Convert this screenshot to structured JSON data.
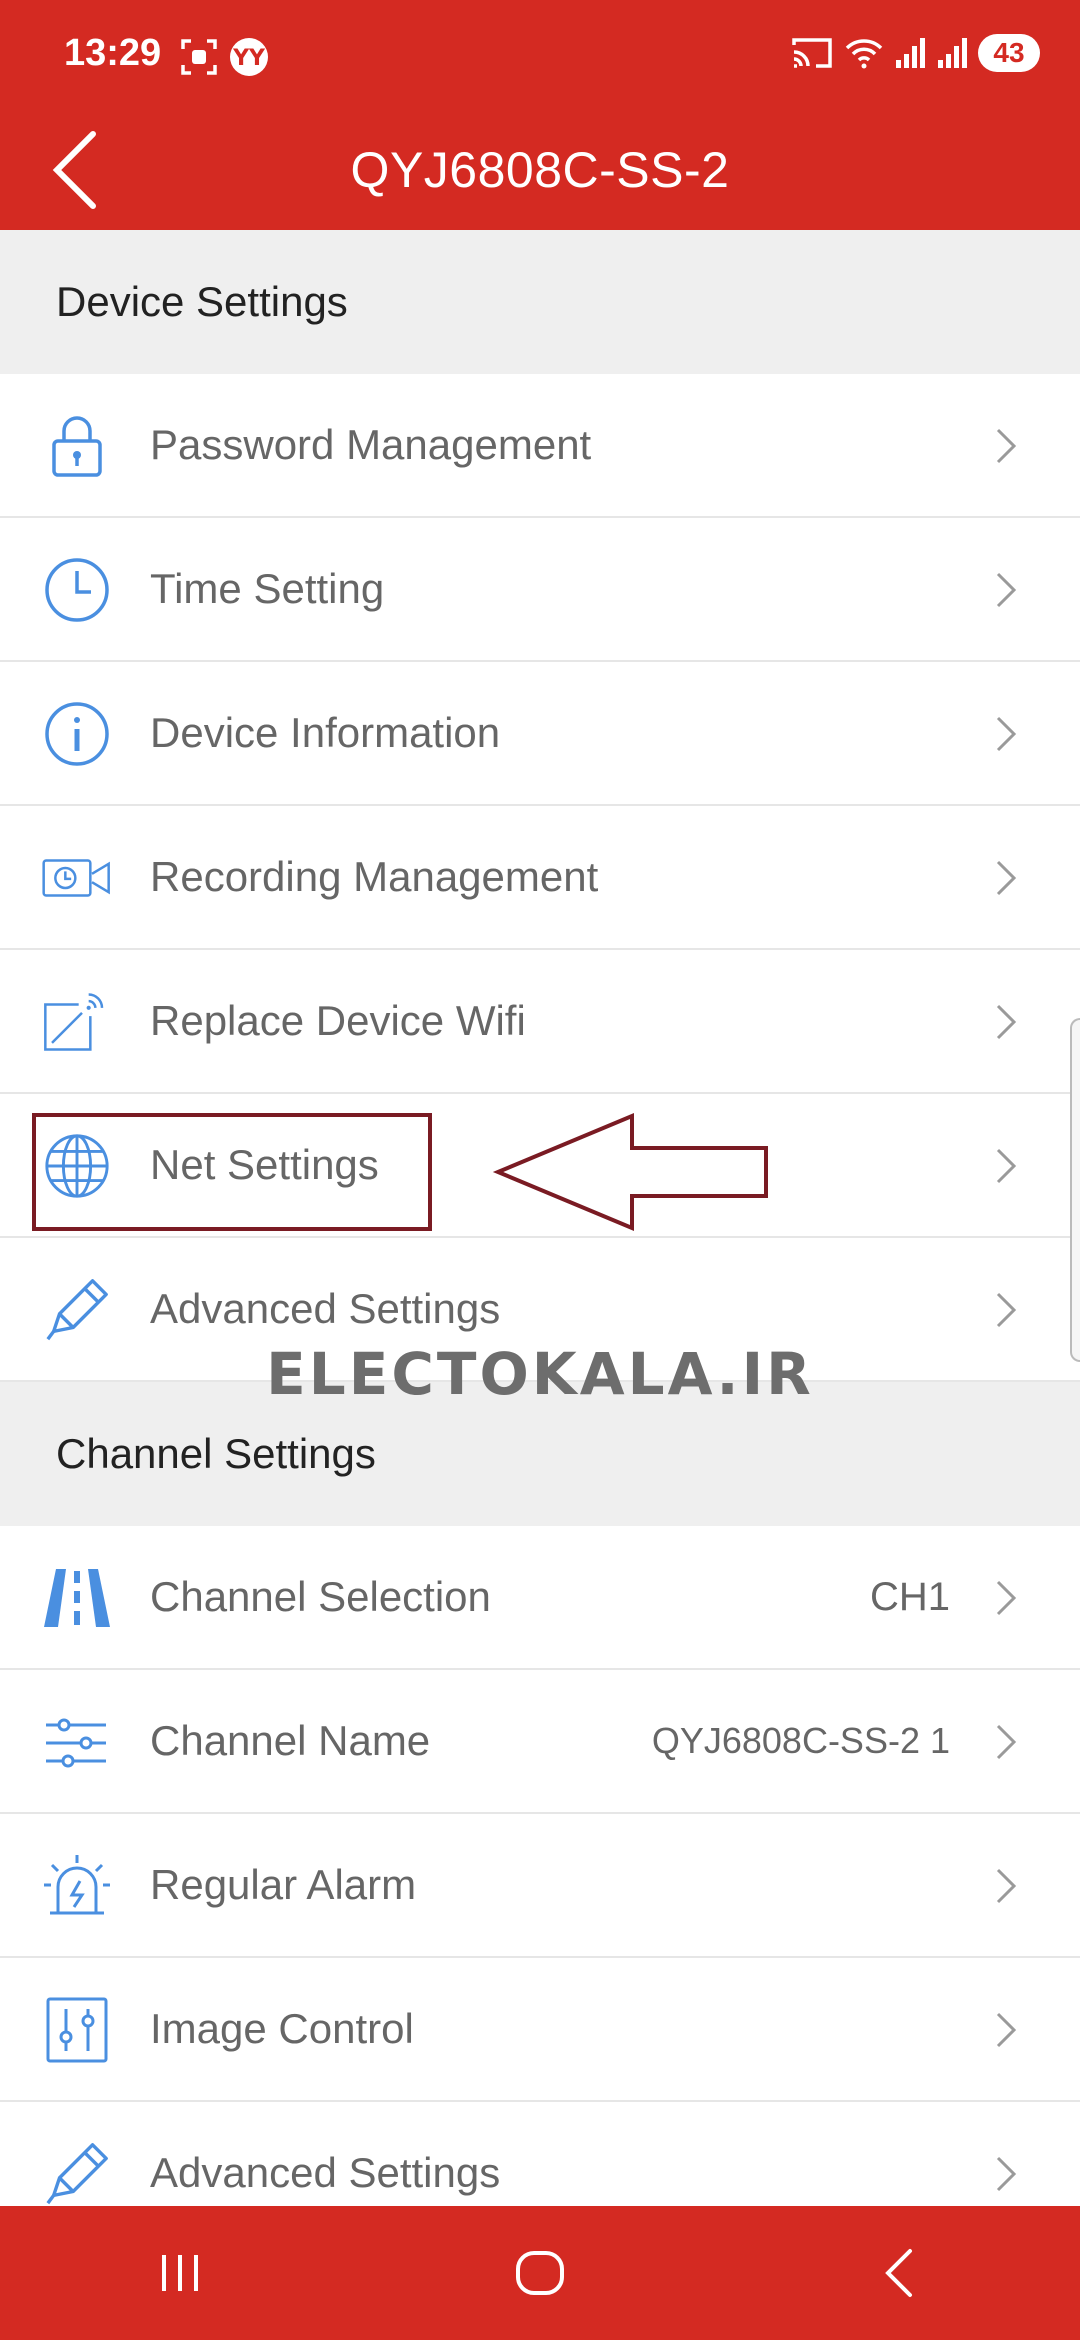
{
  "status_bar": {
    "time": "13:29",
    "battery": "43",
    "icons": [
      "screenshot-icon",
      "app-notification-icon",
      "cast-icon",
      "wifi-icon",
      "signal-icon",
      "signal-icon"
    ]
  },
  "header": {
    "title": "QYJ6808C-SS-2",
    "back_icon": "chevron-left-icon"
  },
  "sections": {
    "device": {
      "title": "Device Settings",
      "items": [
        {
          "label": "Password Management",
          "icon": "lock-icon"
        },
        {
          "label": "Time Setting",
          "icon": "clock-icon"
        },
        {
          "label": "Device Information",
          "icon": "info-icon"
        },
        {
          "label": "Recording Management",
          "icon": "video-camera-icon"
        },
        {
          "label": "Replace Device Wifi",
          "icon": "wifi-edit-icon"
        },
        {
          "label": "Net Settings",
          "icon": "globe-icon"
        },
        {
          "label": "Advanced Settings",
          "icon": "pencil-icon"
        }
      ]
    },
    "channel": {
      "title": "Channel Settings",
      "items": [
        {
          "label": "Channel Selection",
          "value": "CH1",
          "icon": "road-icon"
        },
        {
          "label": "Channel Name",
          "value": "QYJ6808C-SS-2 1",
          "icon": "sliders-icon"
        },
        {
          "label": "Regular Alarm",
          "icon": "alarm-icon"
        },
        {
          "label": "Image Control",
          "icon": "equalizer-icon"
        },
        {
          "label": "Advanced Settings",
          "icon": "pencil-icon"
        }
      ]
    }
  },
  "watermark": "ELECTOKALA.IR",
  "colors": {
    "accent": "#d42a22",
    "icon_blue": "#4a8fe0",
    "highlight": "#7a1b23",
    "background": "#efefef"
  },
  "nav_bar": {
    "icons": [
      "recent-apps-icon",
      "home-icon",
      "back-icon"
    ]
  }
}
